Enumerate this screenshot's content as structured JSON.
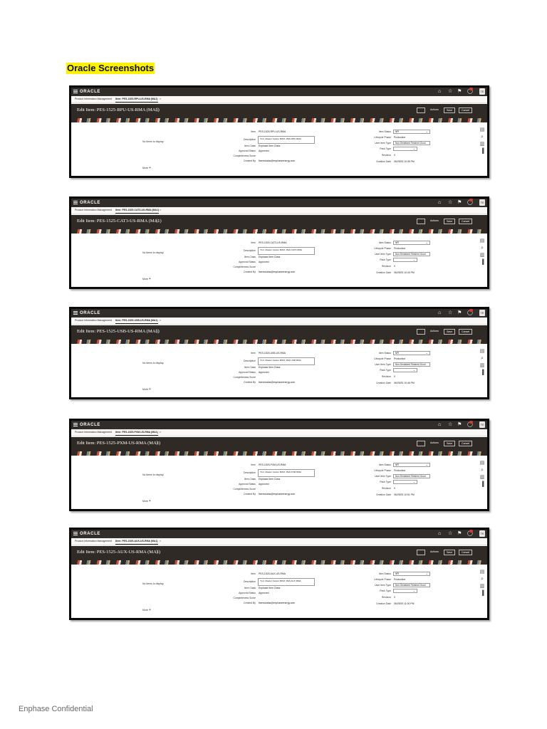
{
  "document": {
    "heading": "Oracle Screenshots",
    "footer": "Enphase Confidential"
  },
  "app": {
    "logo": "ORACLE",
    "module_tab": "Product Information Management",
    "avatar": "TE",
    "icons": [
      "menu-icon",
      "home-icon",
      "star-icon",
      "flag-icon",
      "bell-icon"
    ],
    "colors": {
      "header": "#312d2a",
      "banner": "#2f2a26",
      "heading_highlight": "#fff200"
    }
  },
  "labels": {
    "no_items": "No items to display.",
    "more": "More",
    "item": "Item",
    "description": "Description",
    "item_class": "Item Class",
    "approval_status": "Approval Status",
    "completeness_score": "Completeness Score",
    "created_by": "Created By",
    "item_status": "Item Status",
    "lifecycle_phase": "Lifecycle Phase",
    "user_item_type": "User Item Type",
    "pack_type": "Pack Type",
    "revision": "Revision",
    "creation_date": "Creation Date",
    "actions": "Actions",
    "save": "Save",
    "cancel": "Cancel"
  },
  "screenshots": [
    {
      "tab": "Item: PES-1525-RPU-US-RMA (MA1)",
      "title": "Edit Item: PES-1525-RPU-US-RMA (MA1)",
      "item": "PES-1525-RPU-US-RMA",
      "description": "TLA, Master Carton BOM, PES RPU RMA",
      "item_class": "Enphase Item Class",
      "approval_status": "Approved",
      "created_by": "fseredzalas@enphaseenergy.com",
      "item_status": "NPI",
      "lifecycle_phase": "Production",
      "user_item_type": "Non-Serialized Finished Good",
      "revision": "0",
      "creation_date": "06/29/25 10:35 PM"
    },
    {
      "tab": "Item: PES-1525-CAT3-US-RMA (MA1)",
      "title": "Edit Item: PES-1525-CAT3-US-RMA (MA1)",
      "item": "PES-1525-CAT3-US-RMA",
      "description": "TLA, Master Carton BOM, PES CAT3 RMA",
      "item_class": "Enphase Item Class",
      "approval_status": "Approved",
      "created_by": "fseredzalas@enphaseenergy.com",
      "item_status": "NPI",
      "lifecycle_phase": "Production",
      "user_item_type": "Non-Serialized Finished Good",
      "revision": "0",
      "creation_date": "06/29/25 10:43 PM"
    },
    {
      "tab": "Item: PES-1525-USB-US-RMA (MA1)",
      "title": "Edit Item: PES-1525-USB-US-RMA (MA1)",
      "item": "PES-1525-USB-US-RMA",
      "description": "TLA, Master Carton BOM, PES USB RMA",
      "item_class": "Enphase Item Class",
      "approval_status": "Approved",
      "created_by": "fseredzalas@enphaseenergy.com",
      "item_status": "NPI",
      "lifecycle_phase": "Production",
      "user_item_type": "Non-Serialized Finished Good",
      "revision": "0",
      "creation_date": "06/29/25 10:46 PM"
    },
    {
      "tab": "Item: PES-1525-PXM-US-RMA (MA1)",
      "title": "Edit Item: PES-1525-PXM-US-RMA (MA1)",
      "item": "PES-1525-PXM-US-RMA",
      "description": "TLA, Master Carton BOM, PES PXM RMA",
      "item_class": "Enphase Item Class",
      "approval_status": "Approved",
      "created_by": "fseredzalas@enphaseenergy.com",
      "item_status": "NPI",
      "lifecycle_phase": "Production",
      "user_item_type": "Non-Serialized Finished Good",
      "revision": "0",
      "creation_date": "06/29/25 10:51 PM"
    },
    {
      "tab": "Item: PES-1525-AUX-US-RMA (MA1)",
      "title": "Edit Item: PES-1525-AUX-US-RMA (MA1)",
      "item": "PES-1525-AUX-US-RMA",
      "description": "TLA, Master Carton BOM, PES AUX RMA",
      "item_class": "Enphase Item Class",
      "approval_status": "Approved",
      "created_by": "fseredzalas@enphaseenergy.com",
      "item_status": "NPI",
      "lifecycle_phase": "Production",
      "user_item_type": "Non-Serialized Finished Good",
      "revision": "0",
      "creation_date": "06/29/25 11:00 PM"
    }
  ]
}
